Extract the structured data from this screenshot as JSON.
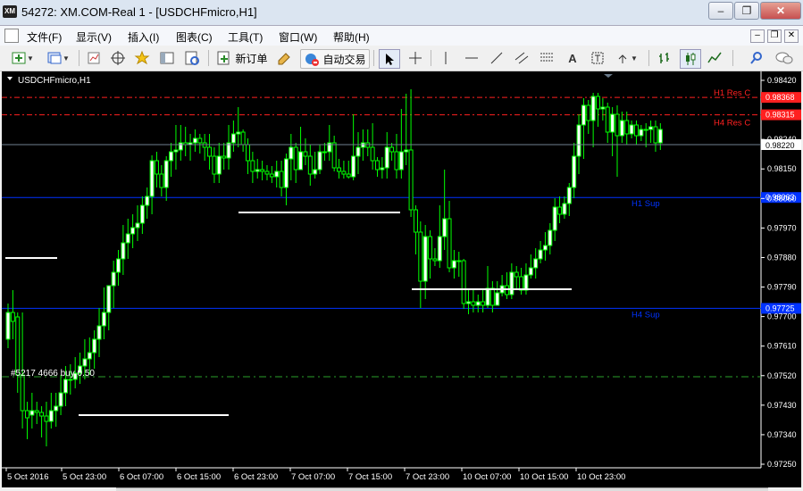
{
  "window": {
    "app_icon": "XM",
    "title": "54272: XM.COM-Real 1 - [USDCHFmicro,H1]",
    "buttons": [
      "minimize-icon",
      "restore-icon",
      "close-icon"
    ]
  },
  "menu": {
    "items": [
      "文件(F)",
      "显示(V)",
      "插入(I)",
      "图表(C)",
      "工具(T)",
      "窗口(W)",
      "帮助(H)"
    ],
    "mdi_buttons": [
      "minimize-icon",
      "restore-icon",
      "close-icon"
    ]
  },
  "toolbar": {
    "new_order_label": "新订单",
    "auto_trade_label": "自动交易",
    "icons": [
      "new-chart-icon",
      "profiles-icon",
      "market-watch-icon",
      "navigator-icon",
      "favorites-icon",
      "data-window-icon",
      "strategy-tester-icon",
      "new-order-icon",
      "meta-editor-icon",
      "auto-trading-icon",
      "cursor-icon",
      "crosshair-icon",
      "vertical-line-icon",
      "horizontal-line-icon",
      "trendline-icon",
      "equidistant-channel-icon",
      "fibonacci-icon",
      "text-icon",
      "text-label-icon",
      "arrows-icon",
      "bar-chart-icon",
      "candlestick-icon",
      "line-chart-icon",
      "zoom-icon",
      "chat-icon"
    ]
  },
  "chart": {
    "symbol_label": "USDCHFmicro,H1",
    "background": "#000000",
    "candle_up_color": "#ffffff",
    "candle_outline_color": "#00ff00",
    "order_label": "#5217 4666 buy 0.50",
    "current_price_label": "0.98220",
    "levels": [
      {
        "label": "H1 Res C",
        "price": 0.98368,
        "price_label": "0.98368",
        "color": "#ff2020",
        "style": "dashdot"
      },
      {
        "label": "H4 Res C",
        "price": 0.98315,
        "price_label": "0.98315",
        "color": "#ff2020",
        "style": "dashdot"
      },
      {
        "label": "H1 Sup",
        "price": 0.98063,
        "price_label": "0.98063",
        "color": "#0033ff",
        "style": "solid"
      },
      {
        "label": "H4 Sup",
        "price": 0.97725,
        "price_label": "0.97725",
        "color": "#0033ff",
        "style": "solid"
      }
    ],
    "price_axis": [
      "0.98420",
      "0.98240",
      "0.98150",
      "0.98060",
      "0.97970",
      "0.97880",
      "0.97790",
      "0.97700",
      "0.97610",
      "0.97520",
      "0.97430",
      "0.97340",
      "0.97250"
    ],
    "time_axis": [
      "5 Oct 2016",
      "5 Oct 23:00",
      "6 Oct 07:00",
      "6 Oct 15:00",
      "6 Oct 23:00",
      "7 Oct 07:00",
      "7 Oct 15:00",
      "7 Oct 23:00",
      "10 Oct 07:00",
      "10 Oct 15:00",
      "10 Oct 23:00"
    ]
  }
}
